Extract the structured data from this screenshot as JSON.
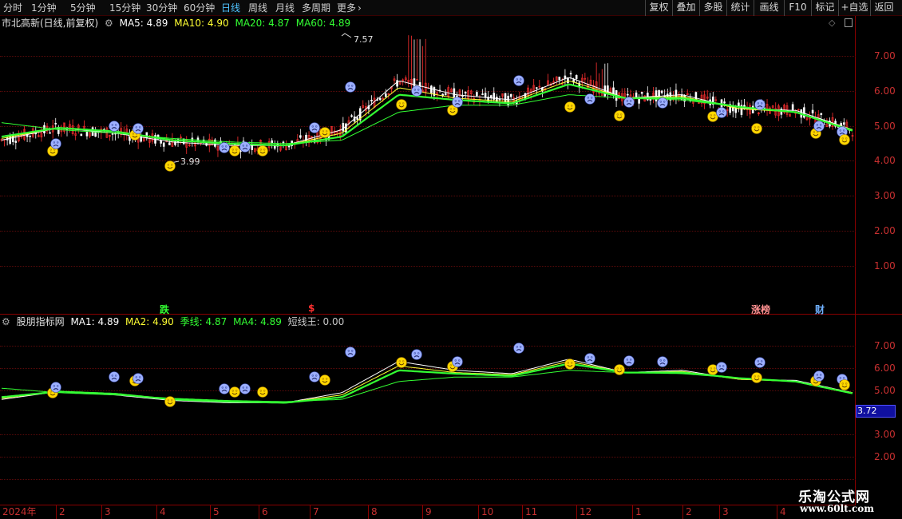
{
  "toolbar": {
    "period_tabs": [
      "分时",
      "1分钟",
      "5分钟",
      "15分钟",
      "30分钟",
      "60分钟",
      "日线",
      "周线",
      "月线",
      "多周期",
      "更多"
    ],
    "active_tab": "日线",
    "right_buttons": [
      "复权",
      "叠加",
      "多股",
      "统计",
      "画线",
      "F10",
      "标记",
      "+自选",
      "返回"
    ]
  },
  "main_panel": {
    "stock_name": "市北高新(日线,前复权)",
    "ma_labels": [
      {
        "text": "MA5: 4.89",
        "color": "#ffffff"
      },
      {
        "text": "MA10: 4.90",
        "color": "#ffff33"
      },
      {
        "text": "MA20: 4.87",
        "color": "#33ff33"
      },
      {
        "text": "MA60: 4.89",
        "color": "#33ff33"
      }
    ],
    "y_labels": [
      "7.00",
      "6.00",
      "5.00",
      "4.00",
      "3.00",
      "2.00",
      "1.00"
    ],
    "high_marker": "7.57",
    "low_marker": "3.99",
    "events": [
      {
        "text": "跌",
        "color": "#33ff33"
      },
      {
        "text": "$",
        "color": "#ff3030"
      },
      {
        "text": "涨榜",
        "color": "#ff9090"
      },
      {
        "text": "财",
        "color": "#6fb0ff"
      }
    ]
  },
  "indicator_panel": {
    "name": "股朋指标网",
    "labels": [
      {
        "text": "MA1: 4.89",
        "color": "#ffffff"
      },
      {
        "text": "MA2: 4.90",
        "color": "#ffff33"
      },
      {
        "text": "季线: 4.87",
        "color": "#33ff33"
      },
      {
        "text": "MA4: 4.89",
        "color": "#33ff33"
      },
      {
        "text": "短线王: 0.00",
        "color": "#c8c8c8"
      }
    ],
    "y_labels": [
      "7.00",
      "6.00",
      "5.00",
      "3.00",
      "2.00"
    ],
    "current_value": "3.72"
  },
  "x_axis": {
    "labels": [
      "2024年",
      "2",
      "3",
      "4",
      "5",
      "6",
      "7",
      "8",
      "9",
      "10",
      "11",
      "12",
      "1",
      "2",
      "3",
      "4"
    ]
  },
  "watermark": {
    "title": "乐淘公式网",
    "url": "www.60lt.com"
  },
  "colors": {
    "background": "#000000",
    "axis": "#c83030",
    "grid": "#5a0a0a",
    "ma5": "#ffffff",
    "ma10": "#ffff33",
    "ma20": "#33ff33",
    "candle_up": "#ff3030",
    "candle_down": "#ffffff",
    "active_tab": "#4fc3ff"
  },
  "chart_data": {
    "type": "line",
    "x": [
      "2024-01",
      "2024-02",
      "2024-03",
      "2024-04",
      "2024-05",
      "2024-06",
      "2024-07",
      "2024-08",
      "2024-09",
      "2024-10",
      "2024-11",
      "2024-12",
      "2025-01",
      "2025-02",
      "2025-03",
      "2025-04"
    ],
    "series": [
      {
        "name": "MA5",
        "values": [
          4.6,
          4.95,
          4.8,
          4.55,
          4.45,
          4.45,
          4.9,
          6.3,
          5.9,
          5.75,
          6.4,
          5.8,
          5.9,
          5.5,
          5.45,
          4.9
        ]
      },
      {
        "name": "MA10",
        "values": [
          4.65,
          4.95,
          4.85,
          4.6,
          4.5,
          4.45,
          4.8,
          6.1,
          5.8,
          5.7,
          6.3,
          5.8,
          5.85,
          5.5,
          5.4,
          4.9
        ]
      },
      {
        "name": "MA20",
        "values": [
          4.7,
          4.95,
          4.85,
          4.6,
          4.5,
          4.45,
          4.7,
          5.9,
          5.75,
          5.65,
          6.2,
          5.8,
          5.8,
          5.55,
          5.4,
          4.87
        ]
      },
      {
        "name": "MA60",
        "values": [
          5.1,
          4.9,
          4.8,
          4.65,
          4.55,
          4.5,
          4.6,
          5.4,
          5.6,
          5.6,
          5.9,
          5.8,
          5.75,
          5.55,
          5.4,
          4.89
        ]
      }
    ],
    "ylim": [
      0.5,
      7.8
    ],
    "high": 7.57,
    "low": 3.99
  }
}
